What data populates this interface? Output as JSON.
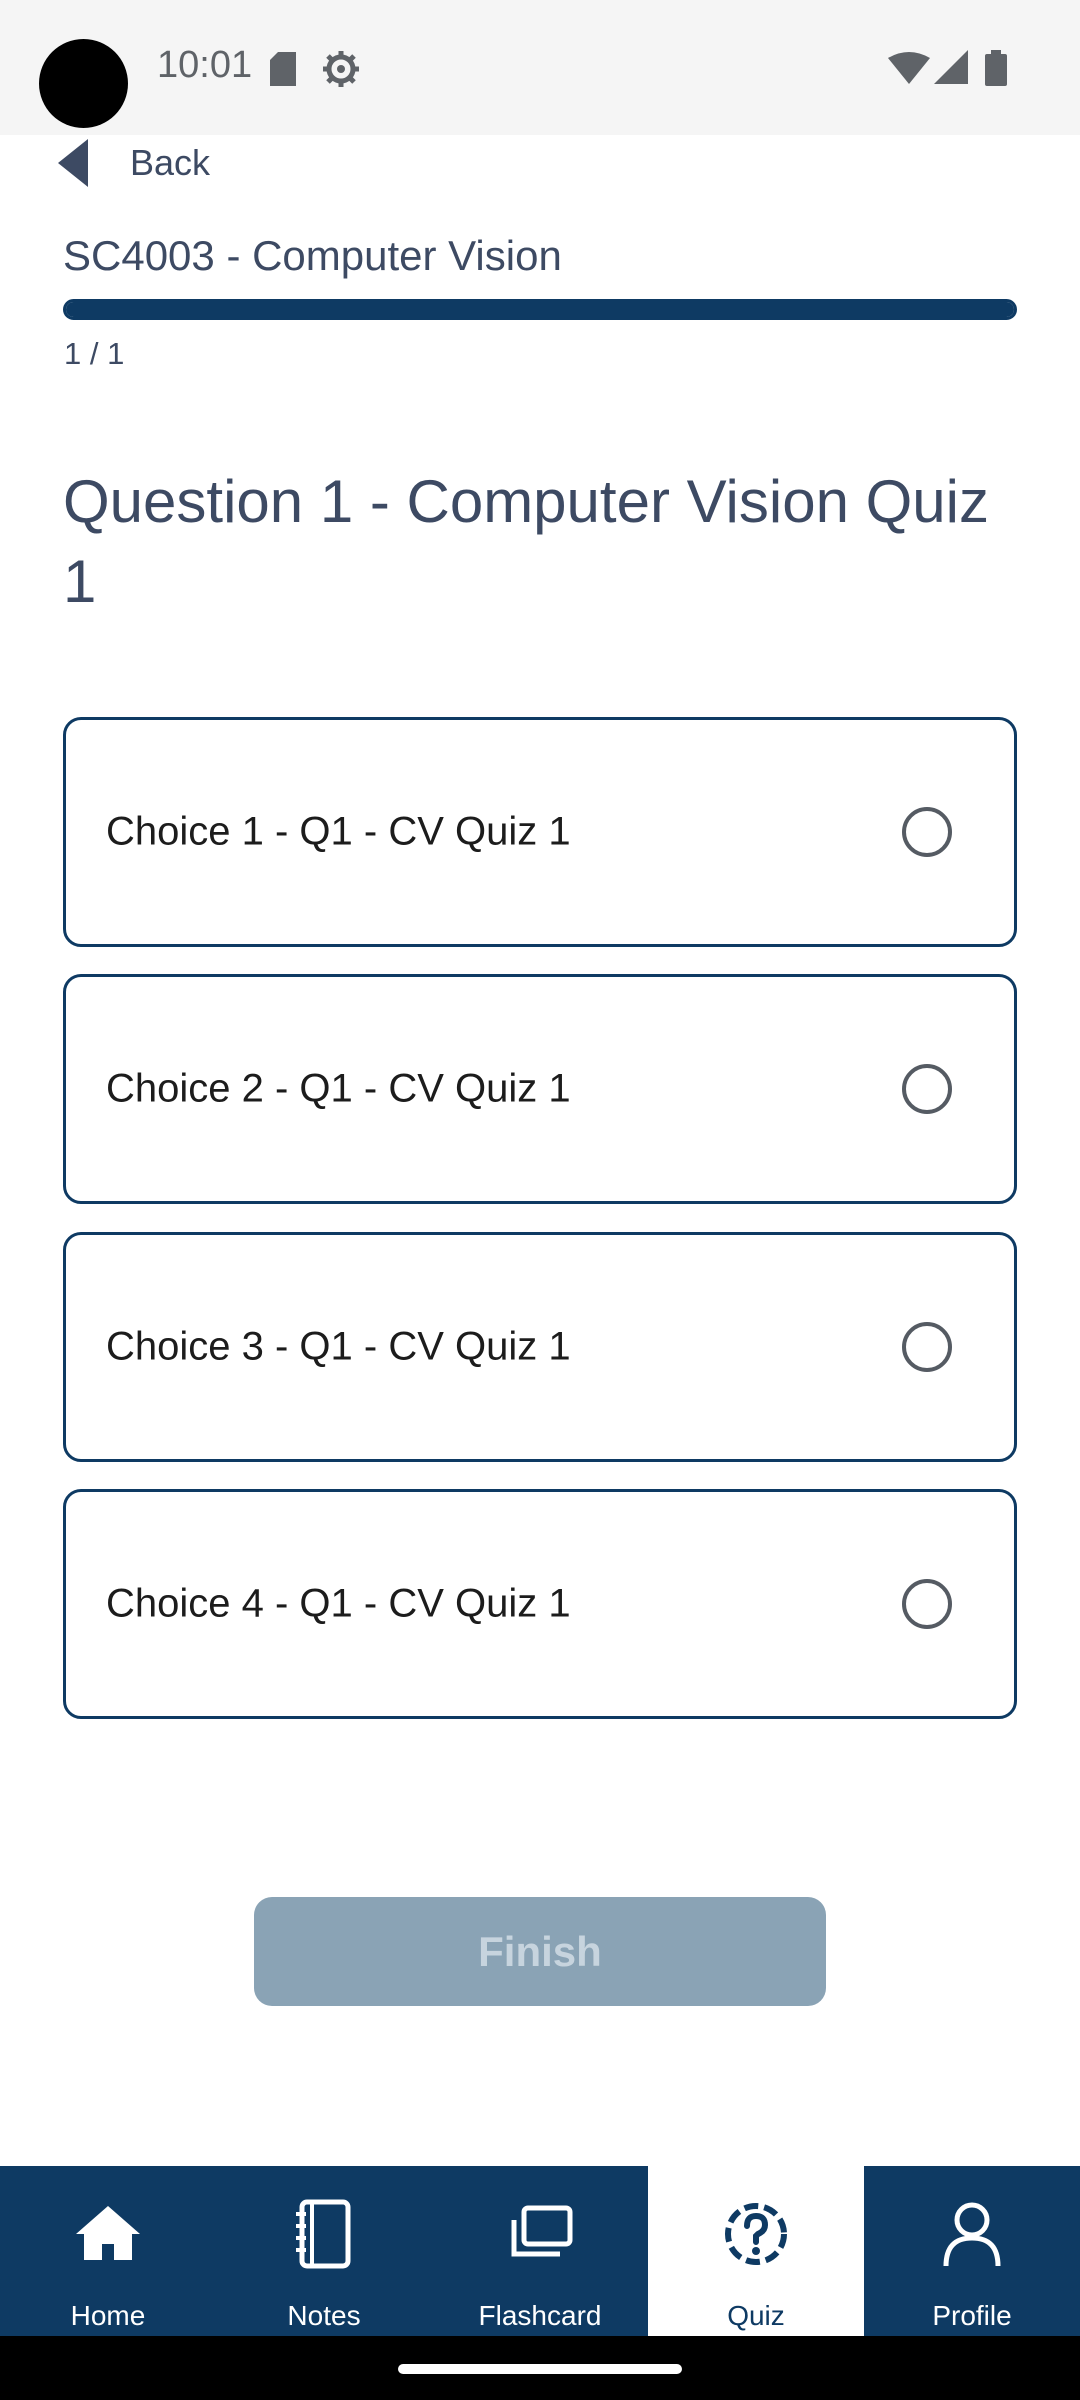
{
  "status_bar": {
    "time": "10:01"
  },
  "nav_header": {
    "back_label": "Back"
  },
  "course": {
    "title": "SC4003 - Computer Vision",
    "progress_label": "1 / 1",
    "progress_fraction": 1.0
  },
  "question": {
    "title": "Question 1 - Computer Vision Quiz 1"
  },
  "choices": [
    {
      "label": "Choice 1 - Q1 - CV Quiz 1",
      "selected": false
    },
    {
      "label": "Choice 2 - Q1 - CV Quiz 1",
      "selected": false
    },
    {
      "label": "Choice 3 - Q1 - CV Quiz 1",
      "selected": false
    },
    {
      "label": "Choice 4 - Q1 - CV Quiz 1",
      "selected": false
    }
  ],
  "finish_button": {
    "label": "Finish",
    "enabled": false
  },
  "bottom_nav": {
    "items": [
      {
        "label": "Home",
        "icon": "home-icon"
      },
      {
        "label": "Notes",
        "icon": "notebook-icon"
      },
      {
        "label": "Flashcard",
        "icon": "flashcard-icon"
      },
      {
        "label": "Quiz",
        "icon": "quiz-icon",
        "active": true
      },
      {
        "label": "Profile",
        "icon": "profile-icon"
      }
    ]
  },
  "colors": {
    "primary": "#0e3a63",
    "text": "#3d4a63",
    "disabled_button": "#8aa3b5"
  }
}
